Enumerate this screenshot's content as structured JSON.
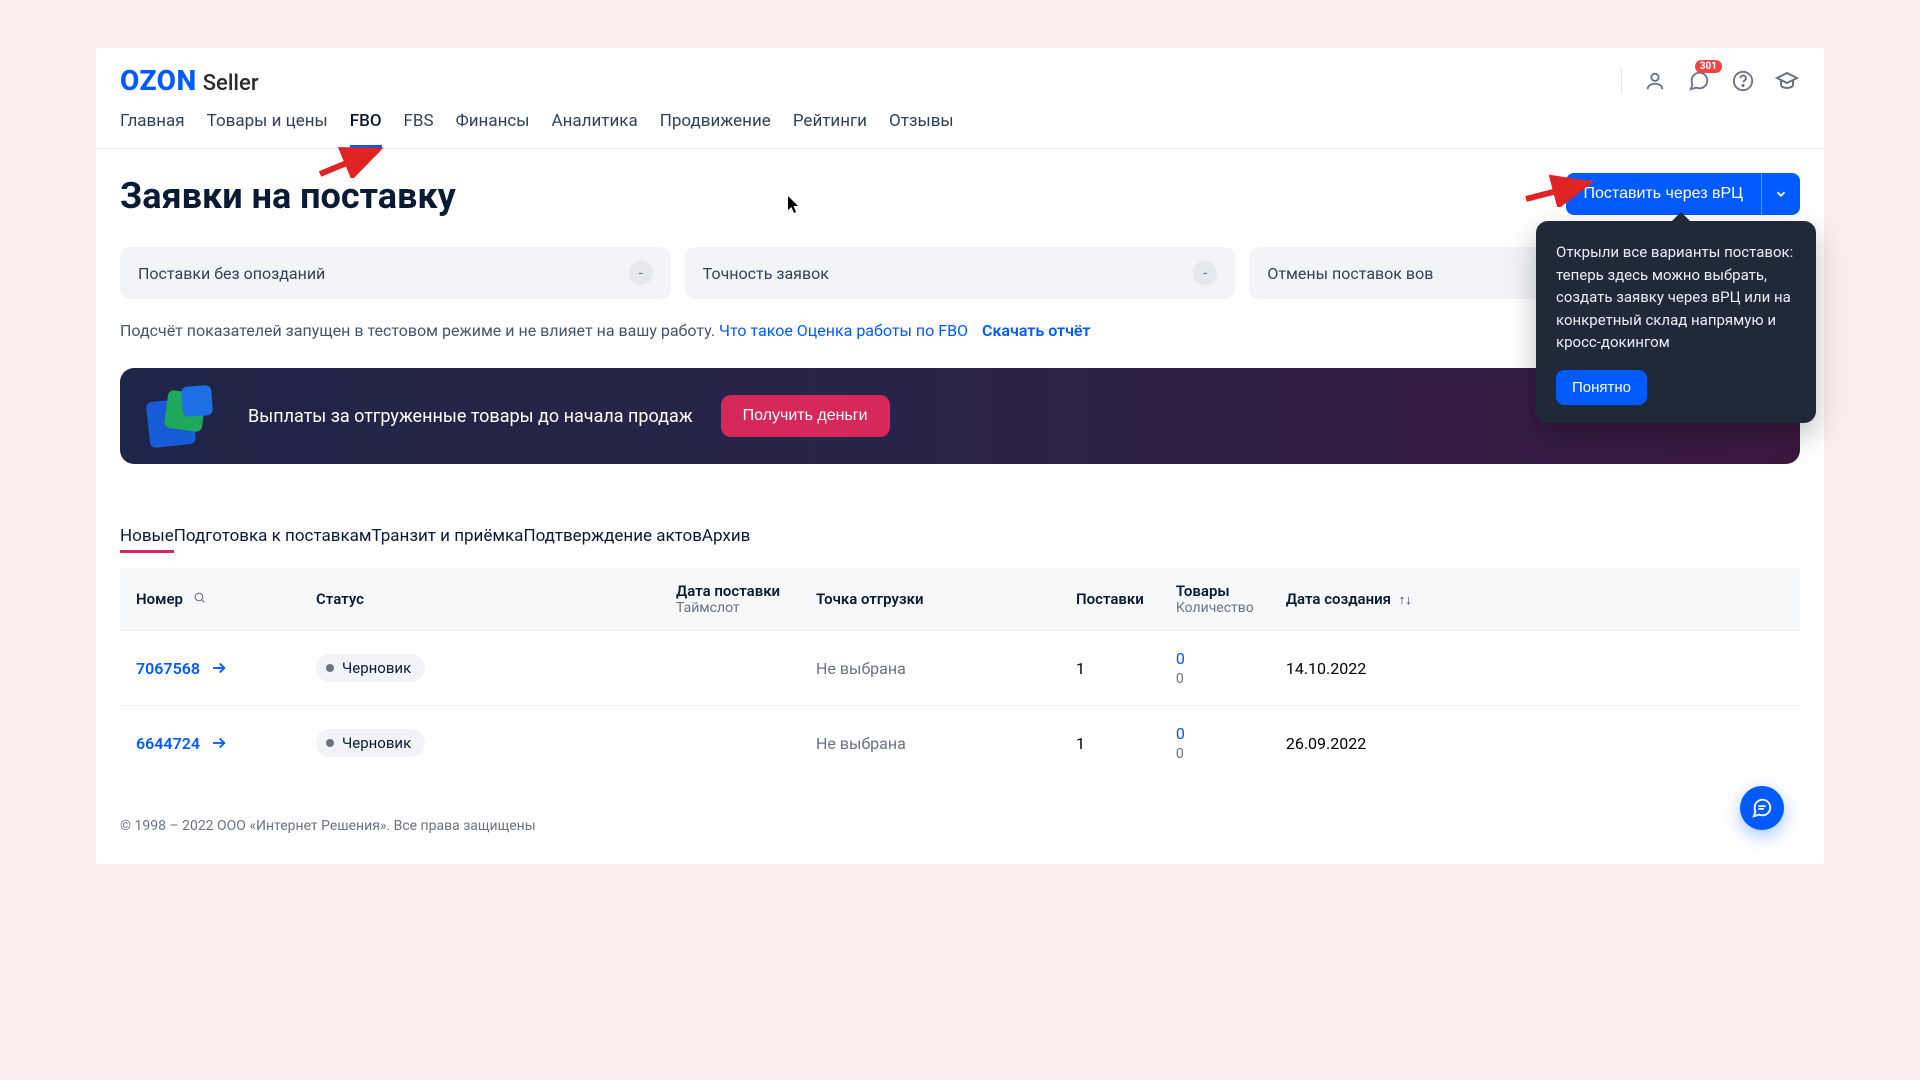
{
  "logo": {
    "brand": "OZON",
    "sub": "Seller"
  },
  "notifications_count": "301",
  "nav": {
    "items": [
      {
        "label": "Главная",
        "active": false
      },
      {
        "label": "Товары и цены",
        "active": false
      },
      {
        "label": "FBO",
        "active": true
      },
      {
        "label": "FBS",
        "active": false
      },
      {
        "label": "Финансы",
        "active": false
      },
      {
        "label": "Аналитика",
        "active": false
      },
      {
        "label": "Продвижение",
        "active": false
      },
      {
        "label": "Рейтинги",
        "active": false
      },
      {
        "label": "Отзывы",
        "active": false
      }
    ]
  },
  "page_title": "Заявки на поставку",
  "cta": {
    "label": "Поставить через вРЦ"
  },
  "tooltip": {
    "text": "Открыли все варианты поставок: теперь здесь можно выбрать, создать заявку через вРЦ или на конкретный склад напрямую и кросс-докингом",
    "button": "Понятно"
  },
  "metrics": [
    {
      "label": "Поставки без опозданий",
      "value": "-"
    },
    {
      "label": "Точность заявок",
      "value": "-"
    },
    {
      "label": "Отмены поставок вов",
      "value": "-"
    }
  ],
  "note": {
    "text": "Подсчёт показателей запущен в тестовом режиме и не влияет на вашу работу. ",
    "link1": "Что такое Оценка работы по FBO",
    "link2": "Скачать отчёт"
  },
  "banner": {
    "text": "Выплаты за отгруженные товары до начала продаж",
    "button": "Получить деньги"
  },
  "tabs2": [
    {
      "label": "Новые",
      "active": true
    },
    {
      "label": "Подготовка к поставкам",
      "active": false
    },
    {
      "label": "Транзит и приёмка",
      "active": false
    },
    {
      "label": "Подтверждение актов",
      "active": false
    },
    {
      "label": "Архив",
      "active": false
    }
  ],
  "table": {
    "headers": {
      "number": "Номер",
      "status": "Статус",
      "delivery_date": "Дата поставки",
      "delivery_date_sub": "Таймслот",
      "ship_point": "Точка отгрузки",
      "supplies": "Поставки",
      "goods": "Товары",
      "goods_sub": "Количество",
      "created": "Дата создания"
    },
    "rows": [
      {
        "number": "7067568",
        "status": "Черновик",
        "ship_point": "Не выбрана",
        "supplies": "1",
        "goods": "0",
        "goods_qty": "0",
        "created": "14.10.2022"
      },
      {
        "number": "6644724",
        "status": "Черновик",
        "ship_point": "Не выбрана",
        "supplies": "1",
        "goods": "0",
        "goods_qty": "0",
        "created": "26.09.2022"
      }
    ]
  },
  "footer": "© 1998 – 2022 ООО «Интернет Решения». Все права защищены"
}
